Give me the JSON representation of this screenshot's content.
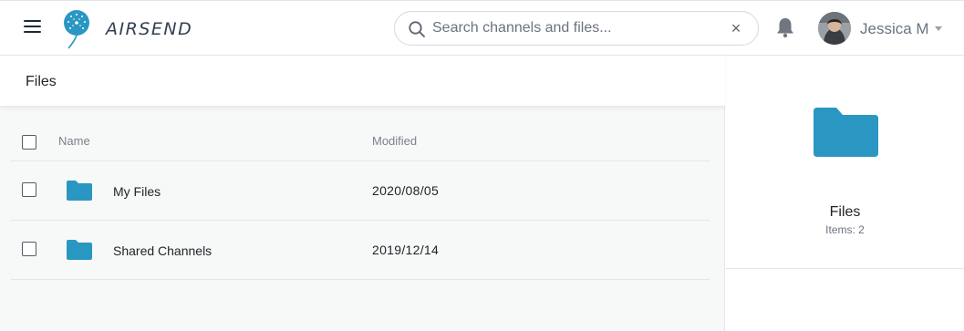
{
  "app": {
    "name": "AIRSEND"
  },
  "search": {
    "placeholder": "Search channels and files..."
  },
  "user": {
    "name": "Jessica M"
  },
  "page": {
    "title": "Files"
  },
  "table": {
    "columns": {
      "name": "Name",
      "modified": "Modified"
    },
    "rows": [
      {
        "name": "My Files",
        "modified": "2020/08/05"
      },
      {
        "name": "Shared Channels",
        "modified": "2019/12/14"
      }
    ]
  },
  "details": {
    "title": "Files",
    "count": "Items: 2"
  },
  "colors": {
    "accent": "#2a97c2",
    "navy": "#1d2a3a"
  },
  "icons": [
    "menu-icon",
    "dandelion-logo-icon",
    "search-icon",
    "close-icon",
    "bell-icon",
    "chevron-down-icon",
    "folder-icon"
  ]
}
